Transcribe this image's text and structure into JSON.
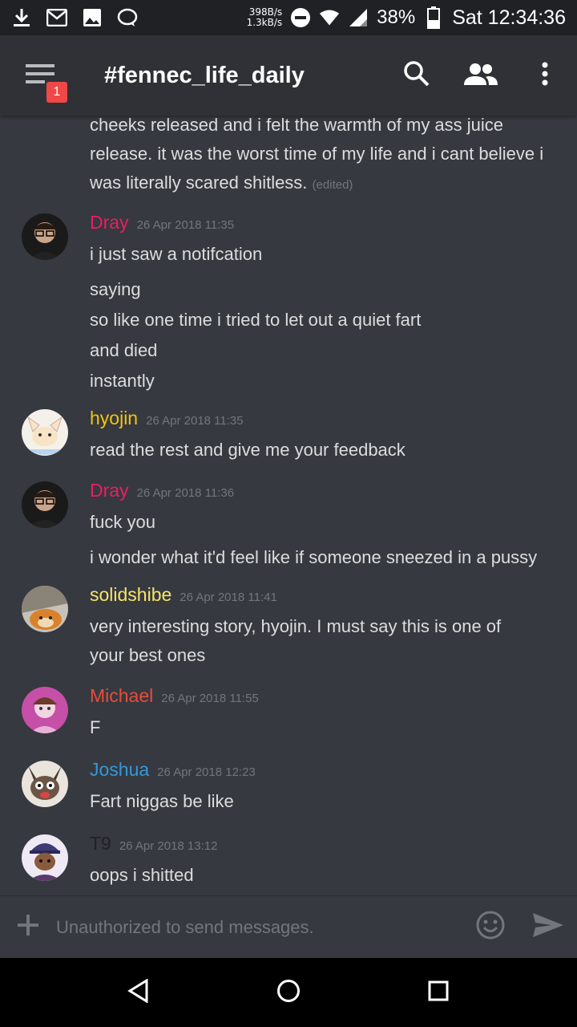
{
  "status_bar": {
    "rate_up": "398B/s",
    "rate_down": "1.3kB/s",
    "battery": "38%",
    "time": "Sat 12:34:36"
  },
  "app_bar": {
    "title": "#fennec_life_daily",
    "badge_count": "1"
  },
  "messages": {
    "continued": {
      "text": "cheeks released and i felt the warmth of my ass juice release. it was the worst time of my life and i cant believe i was literally scared shitless.",
      "edited": "(edited)"
    },
    "groups": [
      {
        "author": "Dray",
        "color": "#e91e63",
        "timestamp": "26 Apr 2018 11:35",
        "lines": [
          "i just saw a notifcation",
          "saying",
          "so like one time i tried to let out a quiet fart",
          "and died",
          "instantly"
        ]
      },
      {
        "author": "hyojin",
        "color": "#f1c40f",
        "timestamp": "26 Apr 2018 11:35",
        "lines": [
          "read the rest and give me your feedback"
        ]
      },
      {
        "author": "Dray",
        "color": "#e91e63",
        "timestamp": "26 Apr 2018 11:36",
        "lines": [
          "fuck you",
          "i wonder what it'd feel like if someone sneezed in a pussy"
        ]
      },
      {
        "author": "solidshibe",
        "color": "#f7e36b",
        "timestamp": "26 Apr 2018 11:41",
        "lines": [
          "very interesting story, hyojin. I must say this is one of",
          "your best ones"
        ]
      },
      {
        "author": "Michael",
        "color": "#e74c3c",
        "timestamp": "26 Apr 2018 11:55",
        "lines": [
          "F"
        ]
      },
      {
        "author": "Joshua",
        "color": "#3498db",
        "timestamp": "26 Apr 2018 12:23",
        "lines": [
          "Fart niggas be like"
        ]
      },
      {
        "author": "T9",
        "color": "#202225",
        "timestamp": "26 Apr 2018 13:12",
        "lines": [
          "oops i shitted"
        ]
      }
    ]
  },
  "input": {
    "placeholder": "Unauthorized to send messages."
  },
  "icons": {
    "status": [
      "download-icon",
      "gmail-icon",
      "image-icon",
      "chat-bubble-icon",
      "dnd-icon",
      "wifi-icon",
      "signal-icon",
      "battery-icon"
    ],
    "app_bar": [
      "menu-icon",
      "search-icon",
      "members-icon",
      "more-vert-icon"
    ],
    "input": [
      "plus-icon",
      "emoji-icon",
      "send-icon"
    ],
    "nav": [
      "back-icon",
      "home-icon",
      "recents-icon"
    ]
  }
}
